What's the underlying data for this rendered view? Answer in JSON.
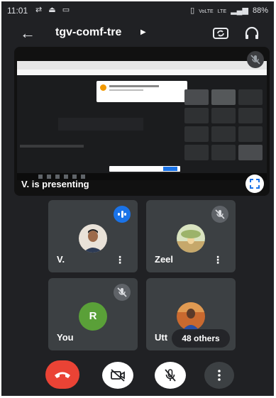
{
  "status_bar": {
    "time": "11:01",
    "left_icons": "⇄ ⏏ ▭",
    "network_1": "VoLTE",
    "network_2": "LTE",
    "battery": "88%"
  },
  "header": {
    "meeting_code": "tgv-comf-tre",
    "back_icon": "back-arrow-icon",
    "switch_camera_icon": "switch-camera-icon",
    "audio_icon": "headphones-icon"
  },
  "presentation": {
    "label": "V. is presenting",
    "mic_state": "muted",
    "expand_icon": "fullscreen-icon"
  },
  "participants": [
    {
      "name": "V.",
      "state": "speaking"
    },
    {
      "name": "Zeel",
      "state": "muted"
    },
    {
      "name": "You",
      "avatar_letter": "R",
      "state": "muted"
    },
    {
      "name": "Utt",
      "state": "unmuted"
    }
  ],
  "others": {
    "label": "48 others"
  },
  "controls": {
    "end_call": "end-call-icon",
    "camera": "camera-off-icon",
    "mic": "mic-off-icon",
    "menu": "more-vert-icon"
  },
  "colors": {
    "background": "#202124",
    "tile": "#3c4043",
    "end_call": "#ea4335",
    "accent": "#1a73e8"
  }
}
